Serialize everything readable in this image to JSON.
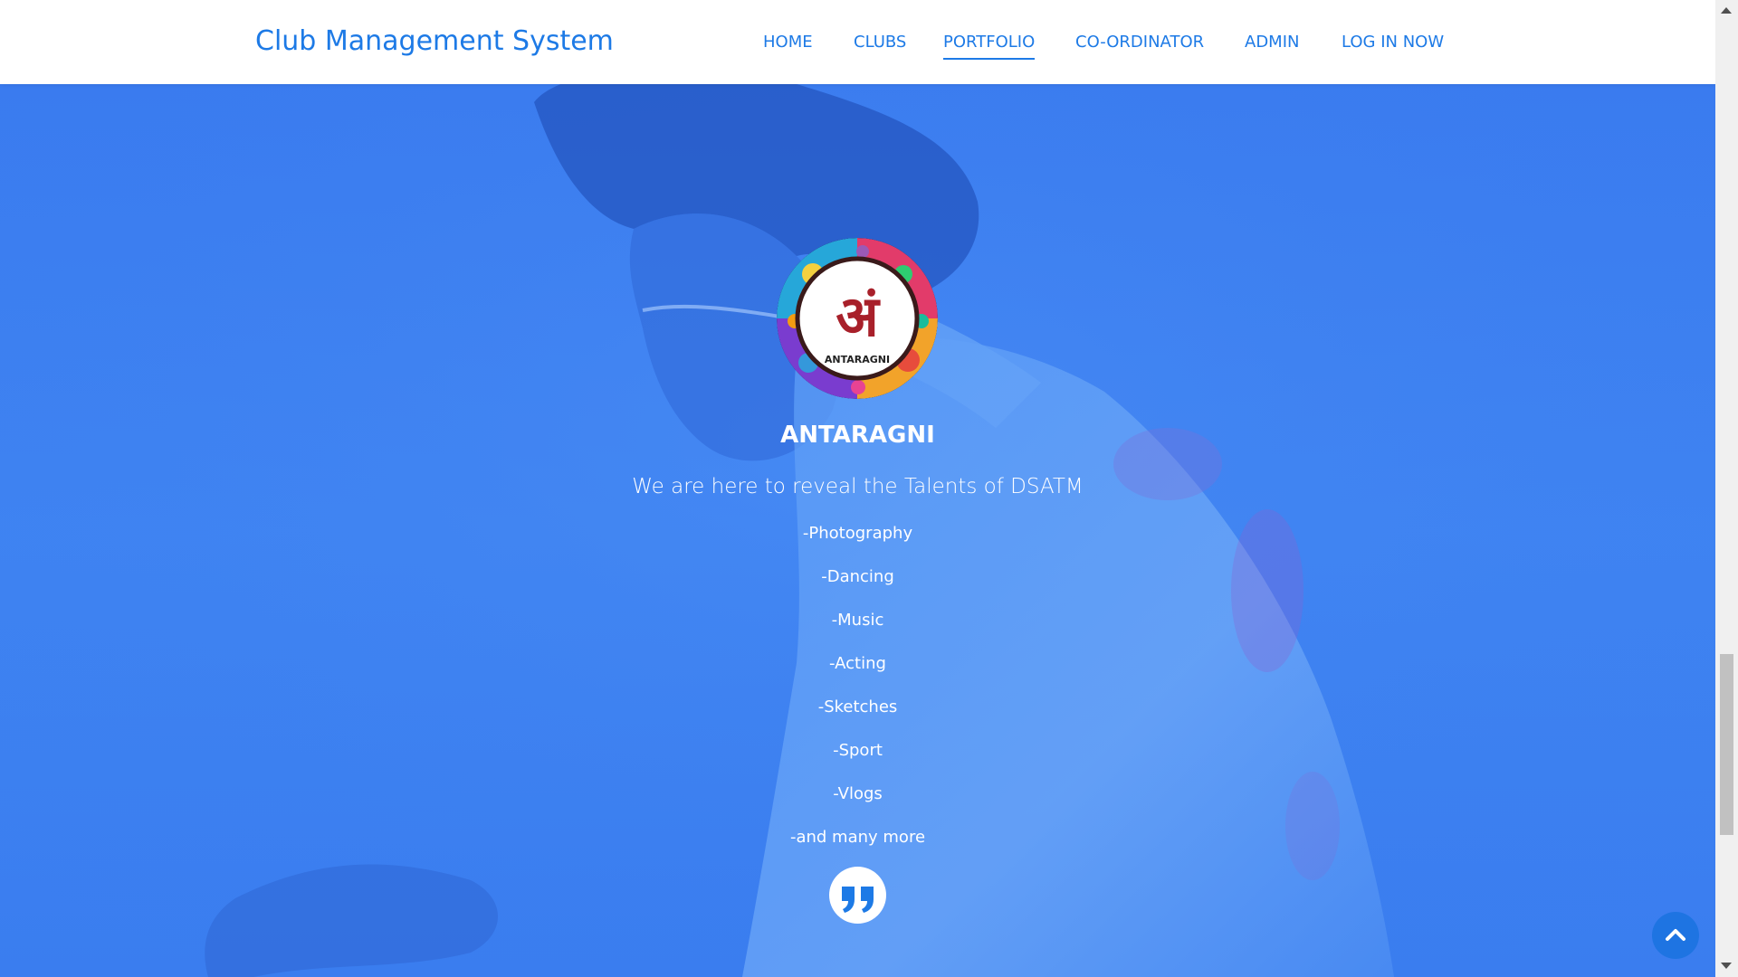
{
  "navbar": {
    "brand": "Club Management System",
    "items": [
      {
        "label": "HOME",
        "active": false
      },
      {
        "label": "CLUBS",
        "active": false
      },
      {
        "label": "PORTFOLIO",
        "active": true
      },
      {
        "label": "CO-ORDINATOR",
        "active": false
      },
      {
        "label": "ADMIN",
        "active": false
      },
      {
        "label": "LOG IN NOW",
        "active": false
      }
    ]
  },
  "portfolio": {
    "logo_text": "ANTARAGNI",
    "logo_glyph": "अं",
    "club_name": "ANTARAGNI",
    "tagline": "We are here to reveal the Talents of DSATM",
    "talents": [
      "-Photography",
      "-Dancing",
      "-Music",
      "-Acting",
      "-Sketches",
      "-Sport",
      "-Vlogs",
      "-and many more"
    ],
    "quote_icon": "quote-icon"
  },
  "colors": {
    "accent": "#1d7ae6",
    "hero_blue": "#3d80f0",
    "white": "#ffffff"
  },
  "icons": {
    "back_to_top": "chevron-up-icon"
  }
}
